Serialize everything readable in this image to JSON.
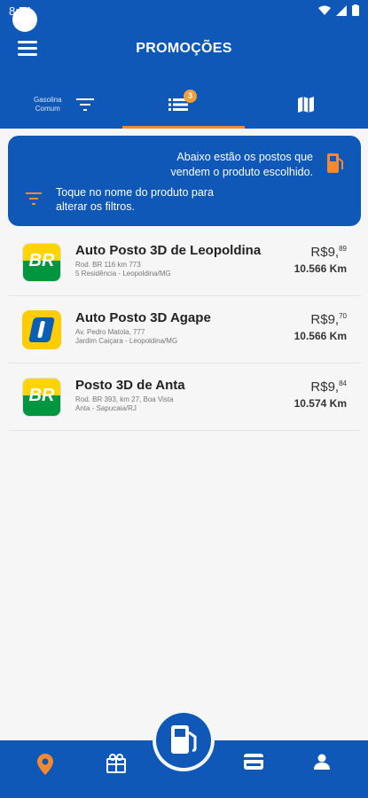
{
  "status": {
    "time": "8:54"
  },
  "header": {
    "title": "PROMOÇÕES"
  },
  "tabs": {
    "fuel_line1": "Gasolina",
    "fuel_line2": "Comum",
    "list_badge": "3"
  },
  "info": {
    "line1": "Abaixo estão os postos que",
    "line2": "vendem o produto escolhido.",
    "hint1": "Toque no nome do produto para",
    "hint2": "alterar os filtros."
  },
  "stations": [
    {
      "name": "Auto Posto 3D de Leopoldina",
      "addr1": "Rod. BR 116 km 773",
      "addr2": "5 Residência - Leopoldina/MG",
      "price_main": "R$9,",
      "price_frac": "89",
      "distance": "10.566 Km",
      "logo": "br-logo"
    },
    {
      "name": "Auto Posto 3D Agape",
      "addr1": "Av. Pedro Matola, 777",
      "addr2": "Jardim Caiçara - Leopoldina/MG",
      "price_main": "R$9,",
      "price_frac": "70",
      "distance": "10.566 Km",
      "logo": "ipiranga-logo"
    },
    {
      "name": "Posto 3D de Anta",
      "addr1": "Rod. BR 393, km 27, Boa Vista",
      "addr2": "Anta - Sapucaia/RJ",
      "price_main": "R$9,",
      "price_frac": "84",
      "distance": "10.574 Km",
      "logo": "br-logo"
    }
  ],
  "colors": {
    "primary": "#0f58b8",
    "accent": "#f28a30",
    "background": "#f6f6f7"
  },
  "nav": {
    "icons": [
      "location-pin-icon",
      "gift-icon",
      "fuel-pump-icon",
      "card-icon",
      "person-icon"
    ]
  }
}
